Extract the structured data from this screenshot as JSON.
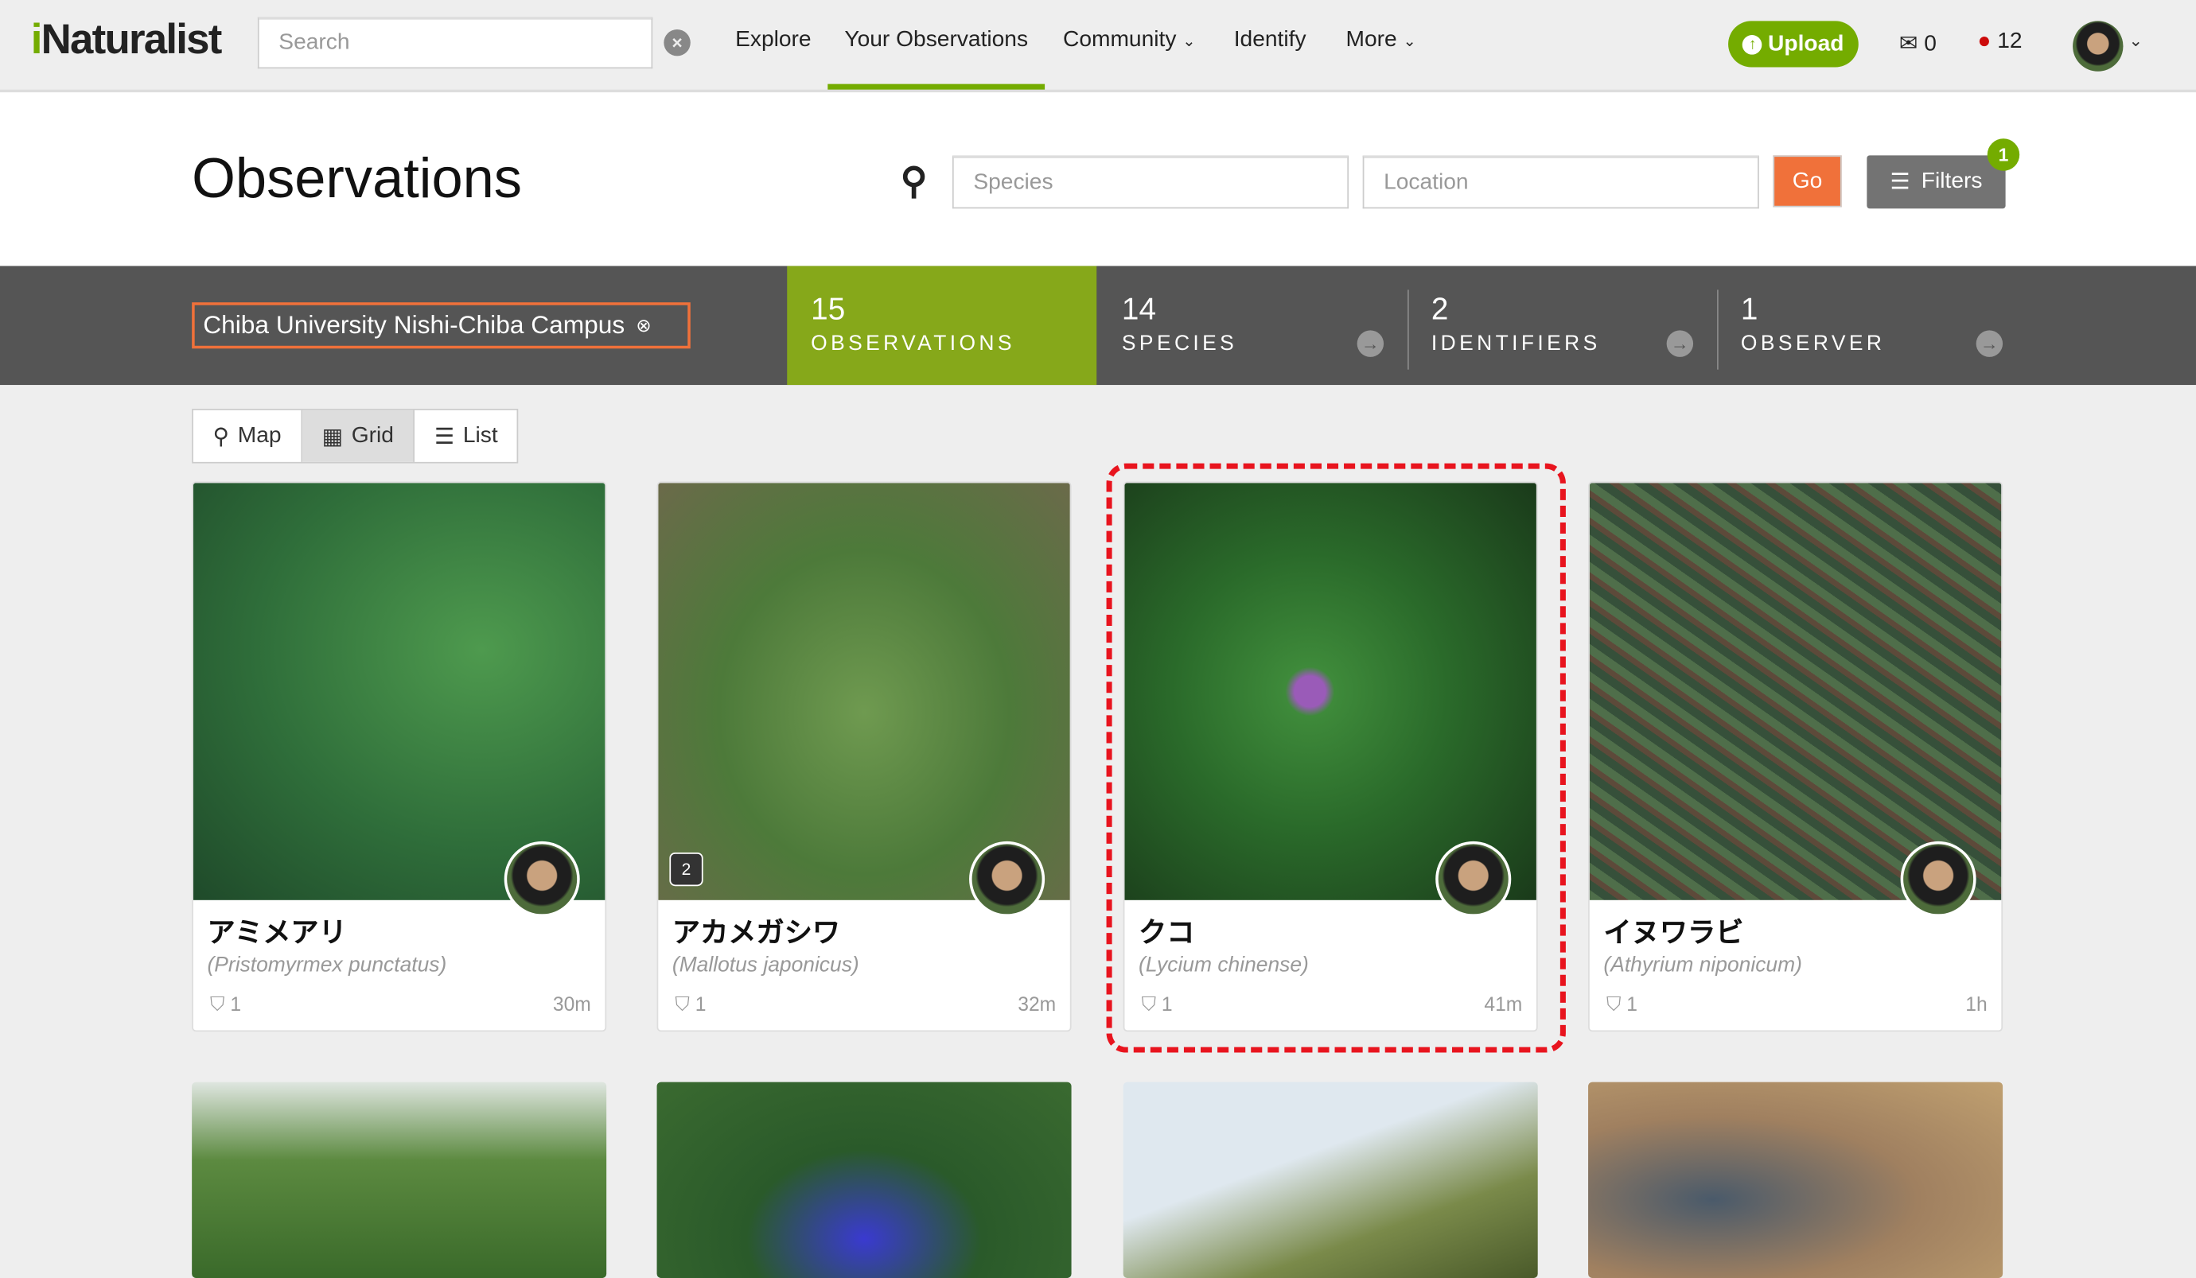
{
  "header": {
    "logo": "iNaturalist",
    "search_placeholder": "Search",
    "nav": [
      "Explore",
      "Your Observations",
      "Community",
      "Identify",
      "More"
    ],
    "upload": "Upload",
    "messages": "0",
    "notifications": "12"
  },
  "page": {
    "title": "Observations",
    "species_placeholder": "Species",
    "location_placeholder": "Location",
    "go": "Go",
    "filters": "Filters",
    "filters_count": "1"
  },
  "stats": {
    "place": "Chiba University Nishi-Chiba Campus",
    "items": [
      {
        "n": "15",
        "l": "OBSERVATIONS"
      },
      {
        "n": "14",
        "l": "SPECIES"
      },
      {
        "n": "2",
        "l": "IDENTIFIERS"
      },
      {
        "n": "1",
        "l": "OBSERVER"
      }
    ]
  },
  "views": [
    "Map",
    "Grid",
    "List"
  ],
  "cards": [
    {
      "name": "アミメアリ",
      "sci": "(Pristomyrmex punctatus)",
      "ids": "1",
      "time": "30m"
    },
    {
      "name": "アカメガシワ",
      "sci": "(Mallotus japonicus)",
      "ids": "1",
      "time": "32m",
      "photos": "2"
    },
    {
      "name": "クコ",
      "sci": "(Lycium chinense)",
      "ids": "1",
      "time": "41m"
    },
    {
      "name": "イヌワラビ",
      "sci": "(Athyrium niponicum)",
      "ids": "1",
      "time": "1h"
    }
  ]
}
